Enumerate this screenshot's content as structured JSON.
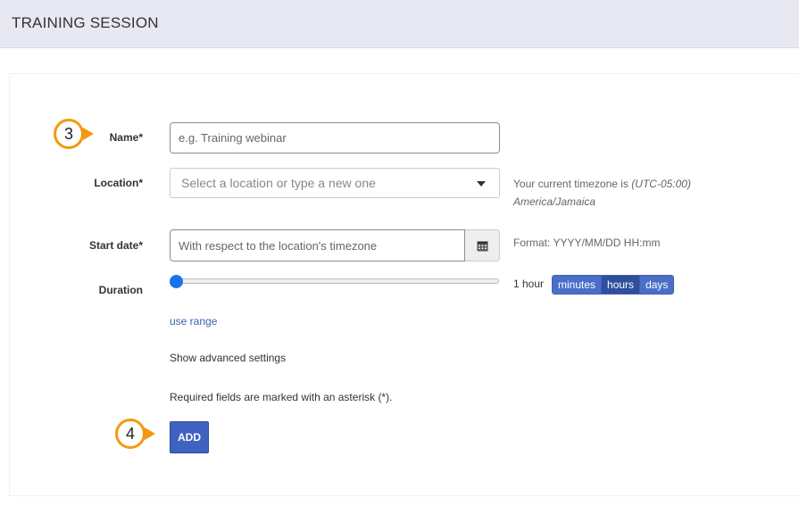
{
  "header": {
    "title": "TRAINING SESSION"
  },
  "form": {
    "name": {
      "label": "Name*",
      "placeholder": "e.g. Training webinar"
    },
    "location": {
      "label": "Location*",
      "placeholder": "Select a location or type a new one",
      "timezone_prefix": "Your current timezone is",
      "timezone_offset": "(UTC-05:00)",
      "timezone_name": "America/Jamaica"
    },
    "start_date": {
      "label": "Start date*",
      "placeholder": "With respect to the location's timezone",
      "format_hint": "Format: YYYY/MM/DD HH:mm"
    },
    "duration": {
      "label": "Duration",
      "value_text": "1 hour",
      "slider_fraction": 0,
      "units": [
        "minutes",
        "hours",
        "days"
      ],
      "active_unit": "hours"
    },
    "use_range": "use range",
    "advanced": "Show advanced settings",
    "required_note": "Required fields are marked with an asterisk (*).",
    "add_button": "ADD"
  },
  "callouts": {
    "step_name": "3",
    "step_add": "4"
  },
  "colors": {
    "accent": "#f29a0e",
    "primary": "#3f62c0",
    "slider": "#1a73e8",
    "header_bg": "#e8e8f2"
  },
  "icons": {
    "calendar": "calendar-icon",
    "dropdown": "chevron-down-icon"
  }
}
